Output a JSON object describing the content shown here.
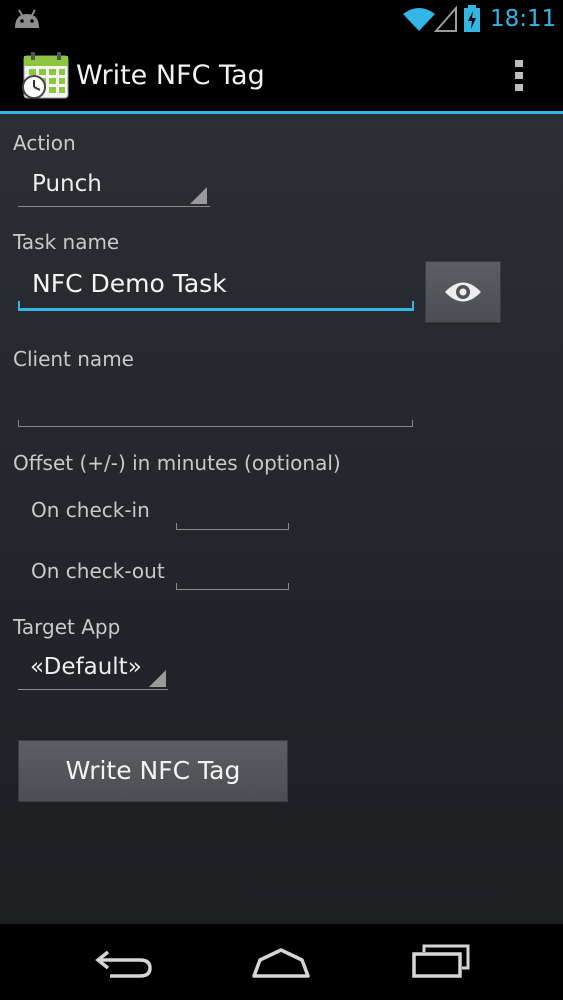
{
  "status_bar": {
    "time": "18:11",
    "android_icon": "android-icon",
    "wifi_icon": "wifi-icon",
    "signal_icon": "signal-icon",
    "battery_icon": "battery-charging-icon"
  },
  "action_bar": {
    "title": "Write NFC Tag",
    "app_icon": "calendar-clock-icon",
    "overflow_icon": "overflow-menu-icon",
    "accent_color": "#33b5e5"
  },
  "form": {
    "action": {
      "label": "Action",
      "selected": "Punch"
    },
    "task_name": {
      "label": "Task name",
      "value": "NFC Demo Task",
      "toggle_icon": "eye-icon"
    },
    "client_name": {
      "label": "Client name",
      "value": ""
    },
    "offset": {
      "label": "Offset (+/-) in minutes (optional)",
      "check_in": {
        "label": "On check-in",
        "value": ""
      },
      "check_out": {
        "label": "On check-out",
        "value": ""
      }
    },
    "target_app": {
      "label": "Target App",
      "selected": "«Default»"
    },
    "write_button": "Write NFC Tag"
  },
  "nav_bar": {
    "back_icon": "back-icon",
    "home_icon": "home-icon",
    "recents_icon": "recent-apps-icon"
  }
}
